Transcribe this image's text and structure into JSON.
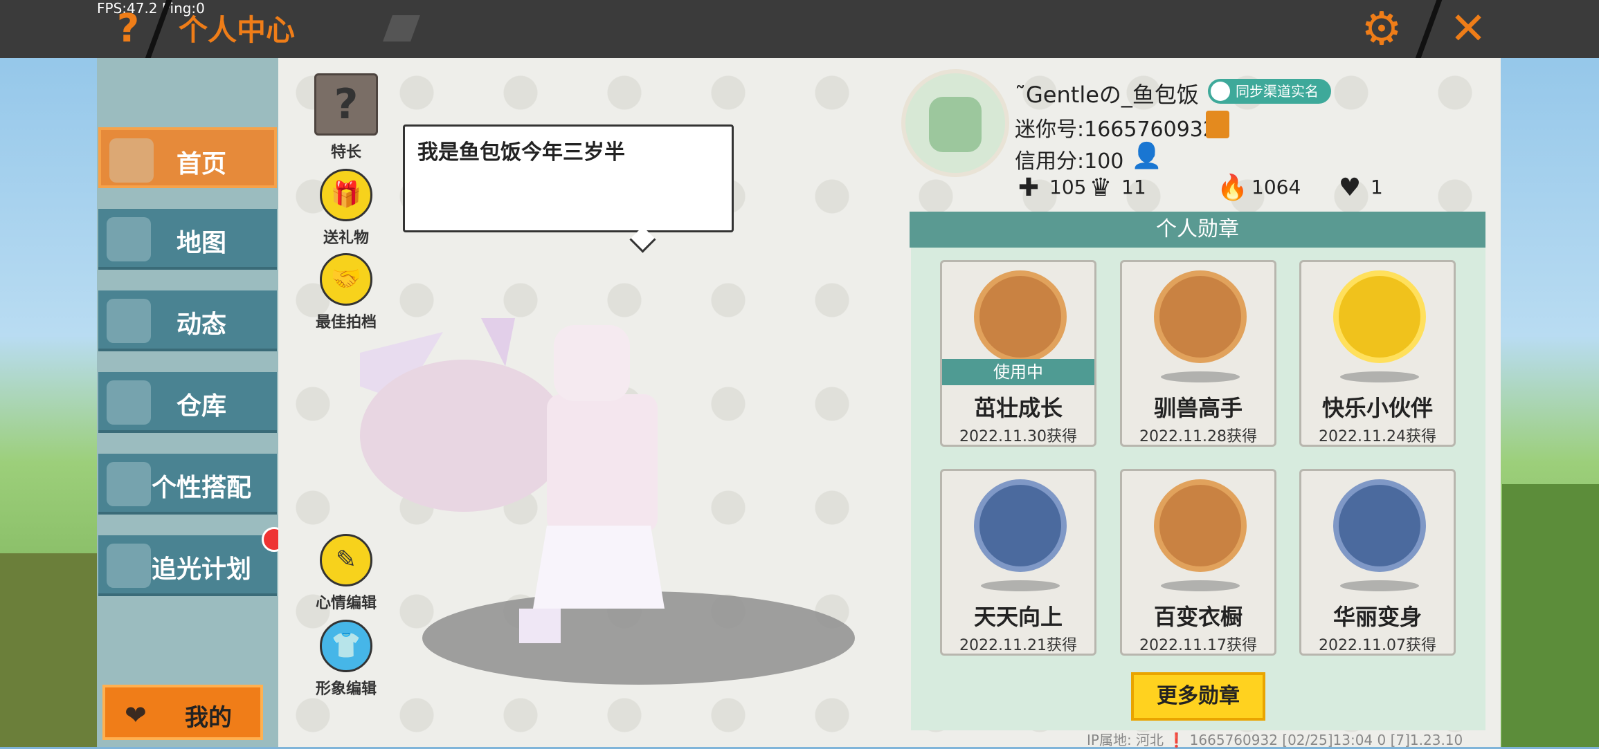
{
  "overlay": {
    "fps": "FPS:47.2  Ping:0"
  },
  "header": {
    "title": "个人中心",
    "help_icon": "question-icon",
    "settings_icon": "gear-icon",
    "close_icon": "close-icon",
    "accent_color": "#ef7d18"
  },
  "sidebar": {
    "items": [
      {
        "label": "首页",
        "icon": "house-icon",
        "active": true
      },
      {
        "label": "地图",
        "icon": "map-icon"
      },
      {
        "label": "动态",
        "icon": "bell-icon"
      },
      {
        "label": "仓库",
        "icon": "warehouse-icon"
      },
      {
        "label": "个性搭配",
        "icon": "outfit-icon"
      },
      {
        "label": "追光计划",
        "icon": "light-plan-icon",
        "has_notification": true
      }
    ],
    "mine_button": "我的"
  },
  "actions": {
    "talent": "特长",
    "gift": "送礼物",
    "best_partner": "最佳拍档",
    "mood_edit": "心情编辑",
    "look_edit": "形象编辑"
  },
  "speech_bubble": {
    "text": "我是鱼包饭今年三岁半"
  },
  "profile": {
    "nickname": "˜Gentleの_鱼包饭",
    "verify_label": "同步渠道实名",
    "mini_id": "迷你号:1665760932",
    "credit": "信用分:100",
    "stats": [
      {
        "icon": "add-friend-icon",
        "value": "105"
      },
      {
        "icon": "fans-icon",
        "value": "11"
      },
      {
        "icon": "fire-icon",
        "value": "1064"
      },
      {
        "icon": "heart-icon",
        "value": "1"
      }
    ]
  },
  "medals": {
    "title": "个人勋章",
    "in_use_label": "使用中",
    "items": [
      {
        "name": "茁壮成长",
        "date": "2022.11.30获得",
        "in_use": true
      },
      {
        "name": "驯兽高手",
        "date": "2022.11.28获得"
      },
      {
        "name": "快乐小伙伴",
        "date": "2022.11.24获得"
      },
      {
        "name": "天天向上",
        "date": "2022.11.21获得"
      },
      {
        "name": "百变衣橱",
        "date": "2022.11.17获得"
      },
      {
        "name": "华丽变身",
        "date": "2022.11.07获得"
      }
    ],
    "more_button": "更多勋章"
  },
  "footer": {
    "text": "IP属地: 河北 ❗  1665760932   [02/25]13:04 0  [7]1.23.10"
  }
}
